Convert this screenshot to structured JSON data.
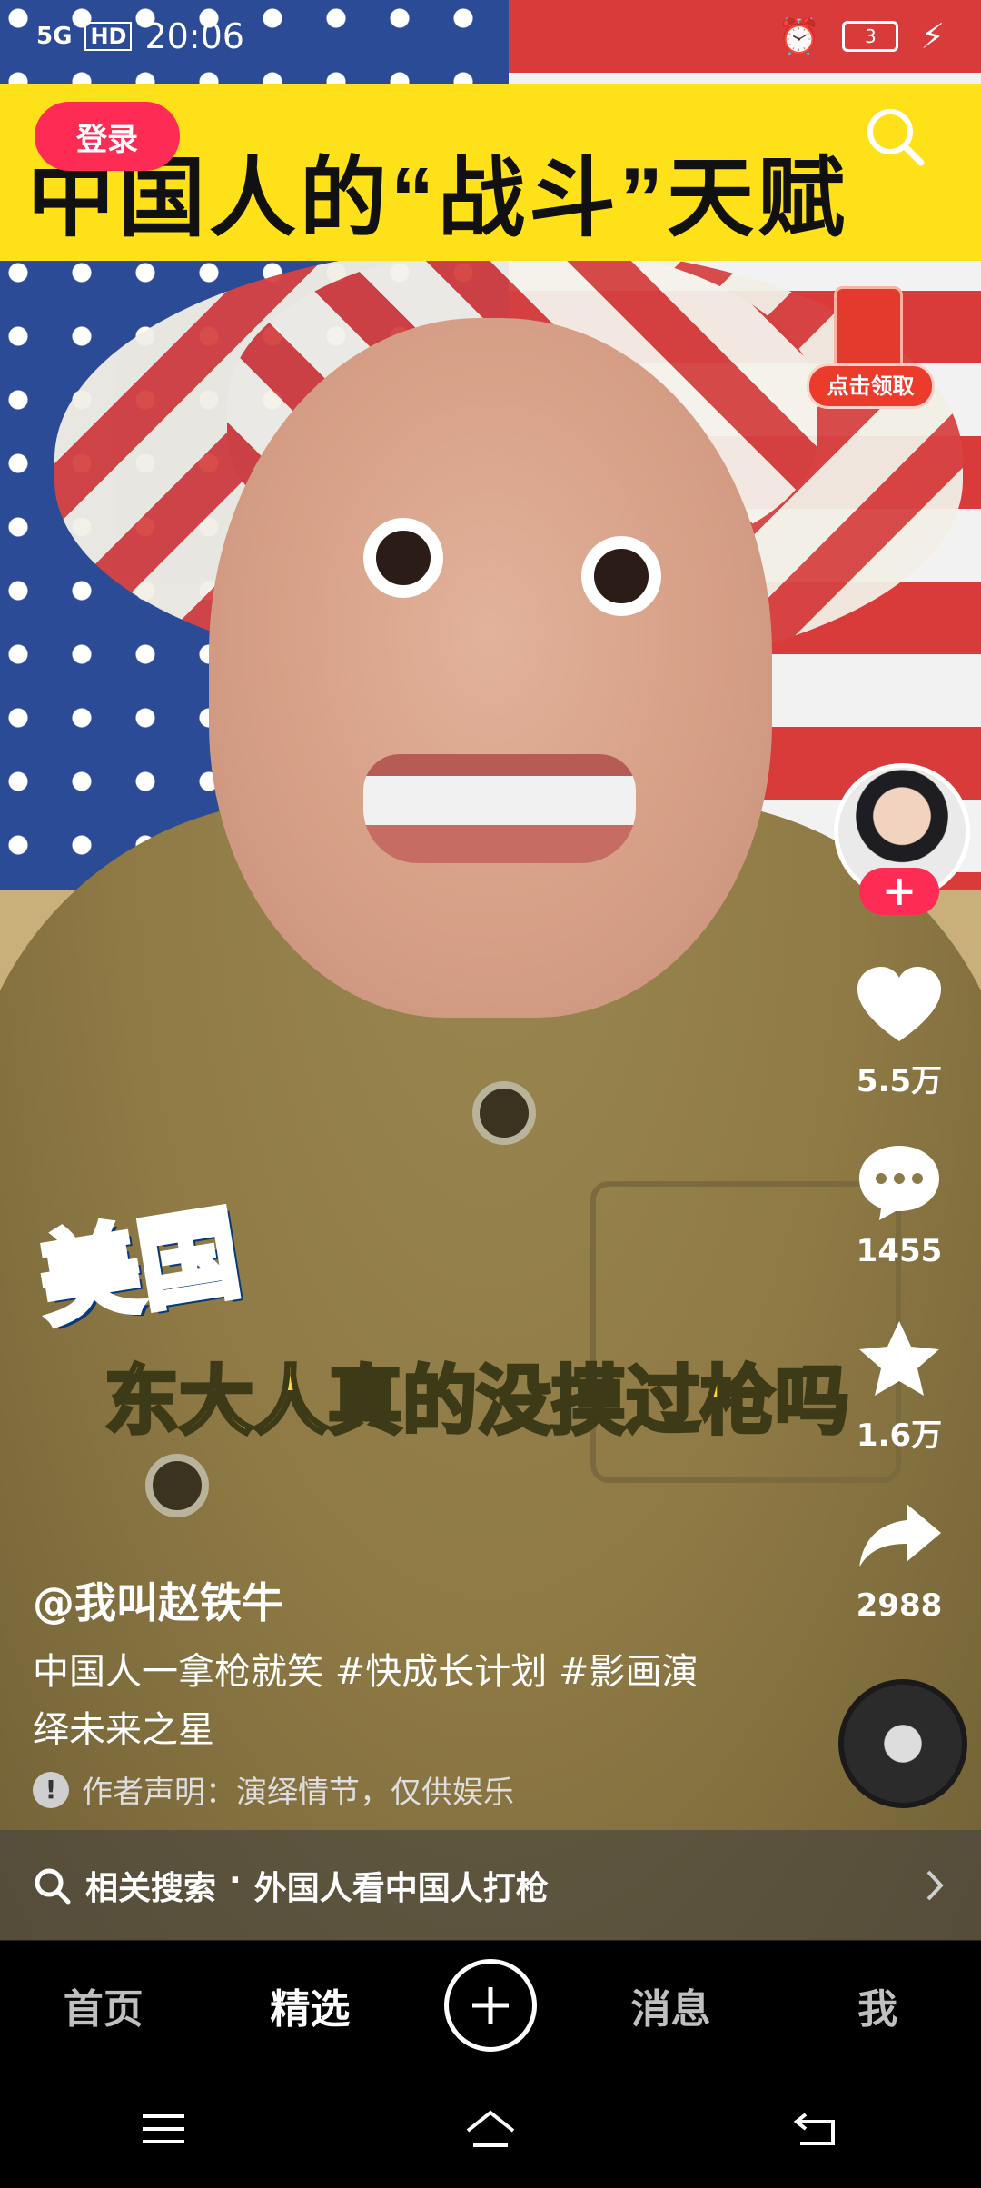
{
  "status_bar": {
    "network": "5G",
    "hd_label": "HD",
    "time": "20:06",
    "battery": "3"
  },
  "video": {
    "title_banner": "中国人的“战斗”天赋",
    "overlay_text_1": "美国",
    "overlay_text_2": "东大人真的没摸过枪吗"
  },
  "header": {
    "login_label": "登录"
  },
  "redpacket": {
    "label": "点击领取"
  },
  "actions": {
    "follow_symbol": "+",
    "likes": "5.5万",
    "comments": "1455",
    "favorites": "1.6万",
    "shares": "2988"
  },
  "post": {
    "author": "@我叫赵铁牛",
    "description": "中国人一拿枪就笑 #快成长计划 #影画演绎未来之星",
    "notice": "作者声明：演绎情节，仅供娱乐"
  },
  "related_search": {
    "label": "相关搜索",
    "separator": "·",
    "query": "外国人看中国人打枪"
  },
  "tabbar": {
    "tabs": [
      "首页",
      "精选",
      "消息",
      "我"
    ]
  },
  "colors": {
    "accent": "#fe2c55",
    "banner": "#ffe11a"
  }
}
